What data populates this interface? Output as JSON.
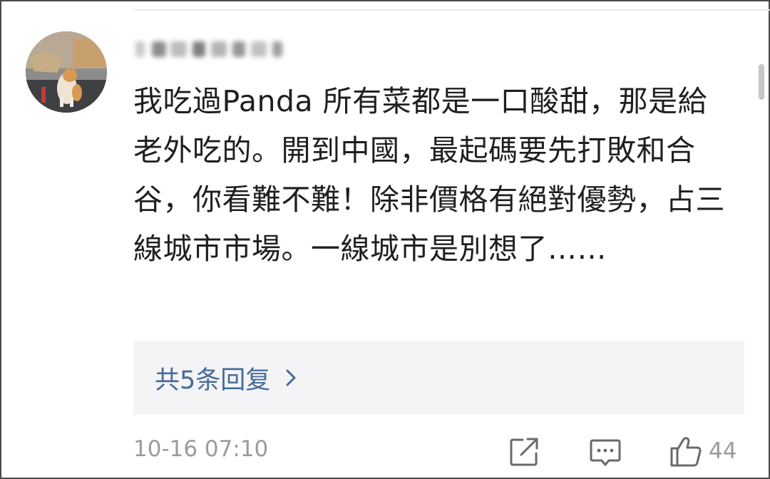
{
  "comment": {
    "avatar_icon": "cat-avatar",
    "text": "我吃過Panda 所有菜都是一口酸甜，那是給老外吃的。開到中國，最起碼要先打敗和合谷，你看難不難！除非價格有絕對優勢，占三線城市市場。一線城市是別想了……",
    "replies_label": "共5条回复",
    "timestamp": "10-16 07:10",
    "like_count": "44"
  },
  "icons": {
    "share": "share-icon",
    "comment": "comment-icon",
    "like": "thumbs-up-icon",
    "chevron": "chevron-right-icon"
  },
  "colors": {
    "text": "#1f1f1f",
    "link": "#456b98",
    "meta": "#9b9b9b",
    "reply_bg": "#f4f4f6"
  }
}
